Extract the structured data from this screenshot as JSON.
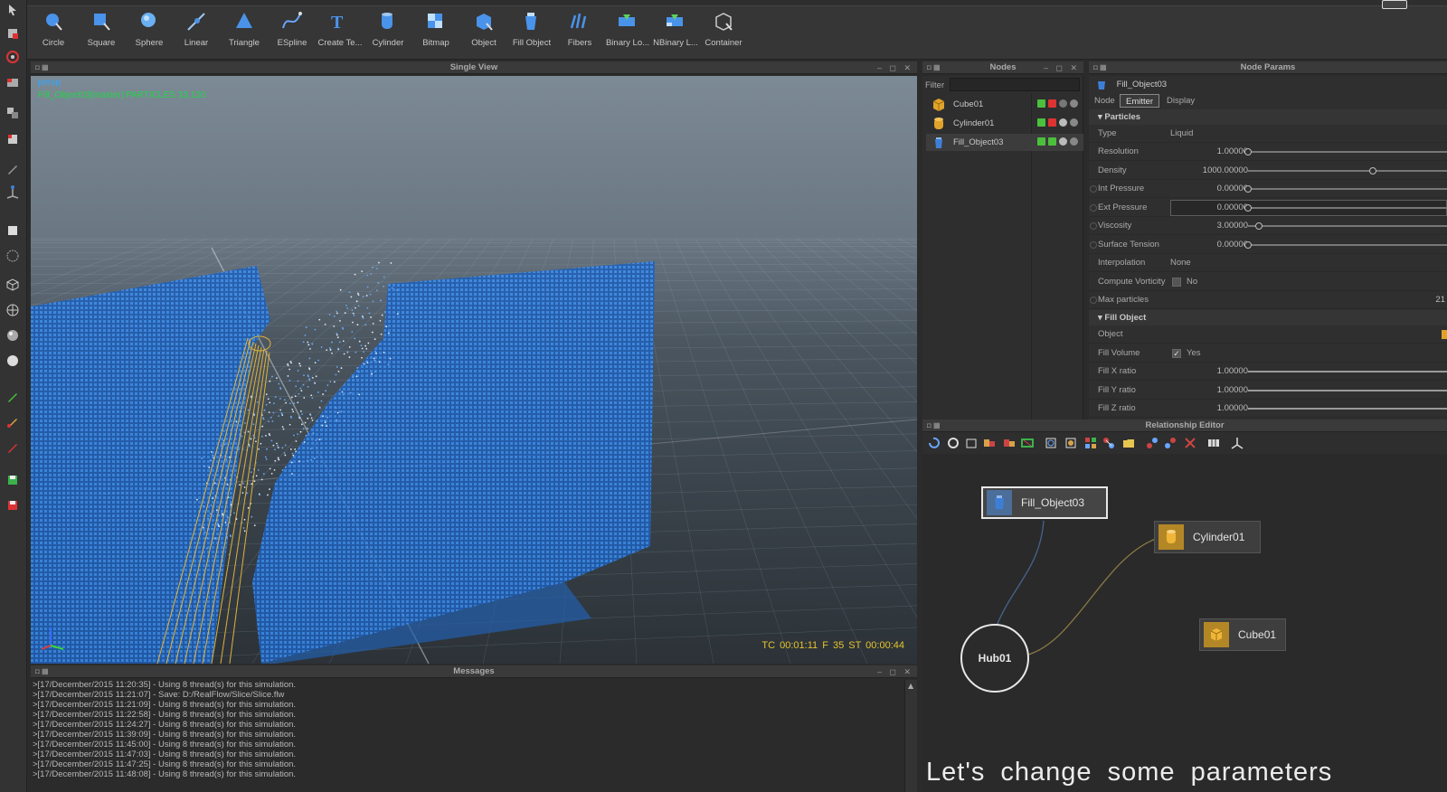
{
  "toolbar": {
    "tools": [
      {
        "label": "Circle",
        "icon": "circle-emitter-icon"
      },
      {
        "label": "Square",
        "icon": "square-emitter-icon"
      },
      {
        "label": "Sphere",
        "icon": "sphere-emitter-icon"
      },
      {
        "label": "Linear",
        "icon": "linear-emitter-icon"
      },
      {
        "label": "Triangle",
        "icon": "triangle-emitter-icon"
      },
      {
        "label": "ESpline",
        "icon": "espline-emitter-icon"
      },
      {
        "label": "Create Te...",
        "icon": "create-text-emitter-icon"
      },
      {
        "label": "Cylinder",
        "icon": "cylinder-emitter-icon"
      },
      {
        "label": "Bitmap",
        "icon": "bitmap-emitter-icon"
      },
      {
        "label": "Object",
        "icon": "object-emitter-icon"
      },
      {
        "label": "Fill Object",
        "icon": "fill-object-emitter-icon"
      },
      {
        "label": "Fibers",
        "icon": "fibers-emitter-icon"
      },
      {
        "label": "Binary Lo...",
        "icon": "binary-loader-icon"
      },
      {
        "label": "NBinary L...",
        "icon": "nbinary-loader-icon"
      },
      {
        "label": "Container",
        "icon": "container-emitter-icon"
      }
    ]
  },
  "viewport": {
    "title": "Single View",
    "camera_label": "persp",
    "info": "Fill_Object03[master] PARTICLES 33,120",
    "timecode": "TC 00:01:11   F 35   ST 00:00:44"
  },
  "messages": {
    "title": "Messages",
    "lines": [
      ">[17/December/2015 11:20:35] - Using 8 thread(s) for this simulation.",
      ">[17/December/2015 11:21:07] - Save: D:/RealFlow/Slice/Slice.flw",
      ">[17/December/2015 11:21:09] - Using 8 thread(s) for this simulation.",
      ">[17/December/2015 11:22:58] - Using 8 thread(s) for this simulation.",
      ">[17/December/2015 11:24:27] - Using 8 thread(s) for this simulation.",
      ">[17/December/2015 11:39:09] - Using 8 thread(s) for this simulation.",
      ">[17/December/2015 11:45:00] - Using 8 thread(s) for this simulation.",
      ">[17/December/2015 11:47:03] - Using 8 thread(s) for this simulation.",
      ">[17/December/2015 11:47:25] - Using 8 thread(s) for this simulation.",
      ">[17/December/2015 11:48:08] - Using 8 thread(s) for this simulation."
    ]
  },
  "nodes": {
    "title": "Nodes",
    "filter_label": "Filter",
    "items": [
      {
        "label": "Cube01",
        "color": "#e0a32a"
      },
      {
        "label": "Cylinder01",
        "color": "#e0a32a"
      },
      {
        "label": "Fill_Object03",
        "color": "#3d7fd6"
      }
    ]
  },
  "params": {
    "title": "Node Params",
    "object_name": "Fill_Object03",
    "tabs": [
      "Node",
      "Emitter",
      "Display"
    ],
    "section_particles": "Particles",
    "type_label": "Type",
    "type_value": "Liquid",
    "resolution_label": "Resolution",
    "resolution_value": "1.00000",
    "resolution_level": 0.0,
    "density_label": "Density",
    "density_value": "1000.00000",
    "density_level": 0.6,
    "int_pressure_label": "Int Pressure",
    "int_pressure_value": "0.00000",
    "ext_pressure_label": "Ext Pressure",
    "ext_pressure_value": "0.00000",
    "viscosity_label": "Viscosity",
    "viscosity_value": "3.00000",
    "viscosity_level": 0.05,
    "surface_tension_label": "Surface Tension",
    "surface_tension_value": "0.00000",
    "interpolation_label": "Interpolation",
    "interpolation_value": "None",
    "compute_vorticity_label": "Compute Vorticity",
    "compute_vorticity_value": "No",
    "max_particles_label": "Max particles",
    "max_particles_value": "21",
    "section_fill": "Fill Object",
    "object_label": "Object",
    "fill_volume_label": "Fill Volume",
    "fill_volume_value": "Yes",
    "fill_x_label": "Fill X ratio",
    "fill_x_value": "1.00000",
    "fill_y_label": "Fill Y ratio",
    "fill_y_value": "1.00000",
    "fill_z_label": "Fill Z ratio",
    "fill_z_value": "1.00000"
  },
  "relationship": {
    "title": "Relationship Editor",
    "nodes": {
      "fill": "Fill_Object03",
      "cylinder": "Cylinder01",
      "cube": "Cube01",
      "hub": "Hub01"
    }
  },
  "subtitle": "Let's change some parameters",
  "colors": {
    "particles": "#2f7fe6",
    "cylinder_wire": "#e0b23a",
    "overlay_info": "#22d447",
    "timecode": "#e7c32c"
  }
}
